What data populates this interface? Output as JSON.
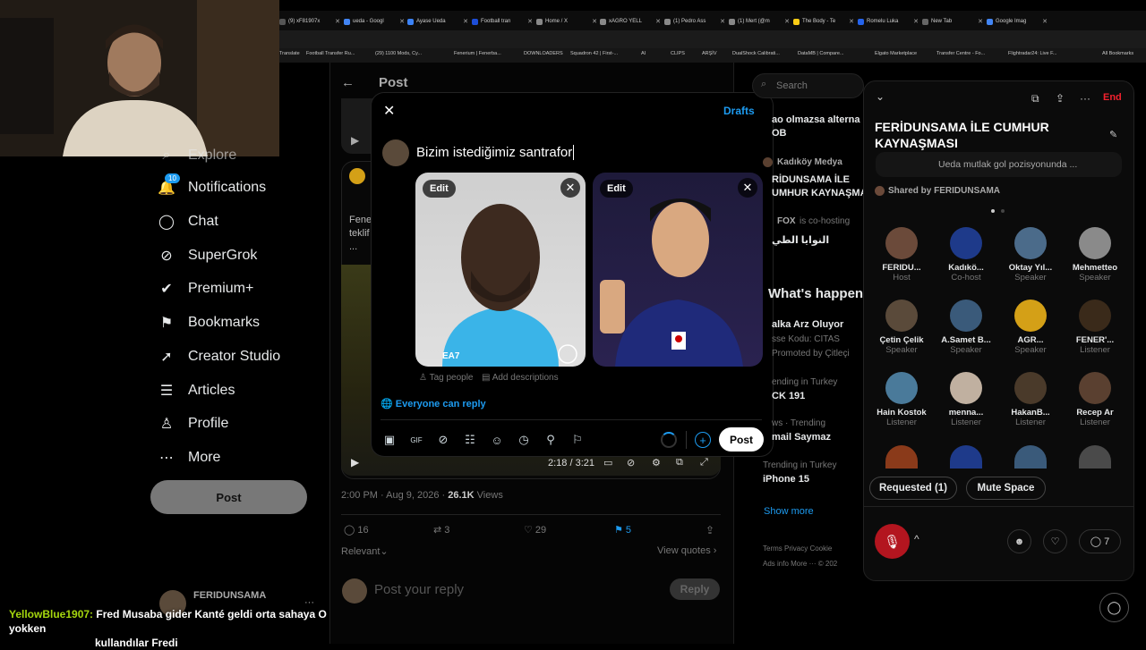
{
  "browser": {
    "tabs": [
      {
        "label": "(9) xF81907x",
        "color": "#555"
      },
      {
        "label": "ueda - Googl",
        "color": "#4285f4"
      },
      {
        "label": "Ayase Ueda",
        "color": "#3b82f6"
      },
      {
        "label": "Football tran",
        "color": "#1d4ed8"
      },
      {
        "label": "Home / X",
        "color": "#888"
      },
      {
        "label": "xAGRO YELL",
        "color": "#888"
      },
      {
        "label": "(1) Pedro Ass",
        "color": "#888"
      },
      {
        "label": "(1) Mert (@m",
        "color": "#888"
      },
      {
        "label": "The Body - Te",
        "color": "#facc15"
      },
      {
        "label": "Romelu Luka",
        "color": "#2563eb"
      },
      {
        "label": "New Tab",
        "color": "#666"
      },
      {
        "label": "Google Imag",
        "color": "#4285f4"
      }
    ],
    "bookmarks": [
      "Translate",
      "Football Transfer Ru...",
      "(29) 1100 Mods, Cy...",
      "Fenerium | Fenerba...",
      "DOWNLOADERS",
      "Squadron 42 | First-...",
      "AI",
      "CLIPS",
      "ARŞİV",
      "DualShock Calibrati...",
      "DataMB | Compare...",
      "Elgato Marketplace",
      "Transfer Centre - Fo...",
      "Flightradar24: Live F...",
      "All Bookmarks"
    ]
  },
  "sidebar": {
    "items": [
      {
        "label": "Explore",
        "icon": "search-icon",
        "glyph": "⌕"
      },
      {
        "label": "Notifications",
        "icon": "bell-icon",
        "glyph": "🔔",
        "badge": "10"
      },
      {
        "label": "Chat",
        "icon": "chat-icon",
        "glyph": "◯"
      },
      {
        "label": "SuperGrok",
        "icon": "grok-icon",
        "glyph": "⊘"
      },
      {
        "label": "Premium+",
        "icon": "verified-icon",
        "glyph": "✔"
      },
      {
        "label": "Bookmarks",
        "icon": "bookmark-icon",
        "glyph": "⚑"
      },
      {
        "label": "Creator Studio",
        "icon": "rocket-icon",
        "glyph": "➚"
      },
      {
        "label": "Articles",
        "icon": "article-icon",
        "glyph": "☰"
      },
      {
        "label": "Profile",
        "icon": "person-icon",
        "glyph": "♙"
      },
      {
        "label": "More",
        "icon": "more-icon",
        "glyph": "⋯"
      }
    ],
    "post_button": "Post",
    "account_name": "FERIDUNSAMA"
  },
  "main": {
    "header": "Post",
    "tweet_preview": {
      "text1": "Fene",
      "text2": "teklif",
      "time_now": "2:18",
      "time_total": "3:21",
      "ellipsis": "..."
    },
    "meta": {
      "datetime": "2:00 PM · Aug 9, 2026 · ",
      "views": "26.1K",
      "views_label": "Views"
    },
    "actions": {
      "replies": "16",
      "reposts": "3",
      "likes": "29",
      "bookmarks": "5"
    },
    "relevant": "Relevant",
    "view_quotes": "View quotes",
    "reply_placeholder": "Post your reply",
    "reply_button": "Reply"
  },
  "compose": {
    "drafts": "Drafts",
    "text": "Bizim istediğimiz santrafor",
    "edit_label": "Edit",
    "tag_people": "Tag people",
    "add_descriptions": "Add descriptions",
    "reply_setting": "Everyone can reply",
    "post_button": "Post"
  },
  "right": {
    "search_placeholder": "Search",
    "trend_snippets": [
      "ao olmazsa alterna",
      "OB"
    ],
    "kadikoy": "Kadıköy Medya",
    "feridun_line1": "RİDUNSAMA İLE",
    "feridun_line2": "UMHUR KAYNAŞMA",
    "fox": "FOX",
    "fox_cohost": "is co-hosting",
    "arabic": "النوايا الطي",
    "whats_happening": "What's happen",
    "trends": [
      {
        "title": "alka Arz Oluyor",
        "sub": "sse Kodu: CITAS",
        "sub2": "Promoted by Çitleçi"
      },
      {
        "small": "ending in Turkey",
        "title": "CK 191"
      },
      {
        "small": "ws · Trending",
        "title": "mail Saymaz"
      },
      {
        "small": "Trending in Turkey",
        "title": "iPhone 15"
      }
    ],
    "show_more": "Show more",
    "footer1": "Terms    Privacy    Cookie",
    "footer2": "Ads info    More ···    © 202"
  },
  "space": {
    "end": "End",
    "title": "FERİDUNSAMA İLE CUMHUR KAYNAŞMASI",
    "pinned": "Ueda mutlak gol pozisyonunda ...",
    "shared_by": "Shared by FERIDUNSAMA",
    "participants": [
      {
        "name": "FERIDU...",
        "role": "Host",
        "color": "#6b4a3a"
      },
      {
        "name": "Kadıkö...",
        "role": "Co-host",
        "color": "#1e3a8a"
      },
      {
        "name": "Oktay Yıl...",
        "role": "Speaker",
        "color": "#4b6b8a"
      },
      {
        "name": "Mehmetteo",
        "role": "Speaker",
        "color": "#8a8a8a"
      },
      {
        "name": "Çetin Çelik",
        "role": "Speaker",
        "color": "#5a4a3a"
      },
      {
        "name": "A.Samet B...",
        "role": "Speaker",
        "color": "#3a5a7a"
      },
      {
        "name": "AGR...",
        "role": "Speaker",
        "color": "#d4a017"
      },
      {
        "name": "FENER'...",
        "role": "Listener",
        "color": "#3a2a1a"
      },
      {
        "name": "Hain Kostok",
        "role": "Listener",
        "color": "#4a7a9a"
      },
      {
        "name": "menna...",
        "role": "Listener",
        "color": "#c0b0a0"
      },
      {
        "name": "HakanB...",
        "role": "Listener",
        "color": "#4a3a2a"
      },
      {
        "name": "Recep Ar",
        "role": "Listener",
        "color": "#5a4030"
      }
    ],
    "requested": "Requested (1)",
    "mute_space": "Mute Space",
    "comments": "7"
  },
  "chat": {
    "user": "YellowBlue1907:",
    "message": "Fred Musaba gider Kanté geldi orta sahaya O yokken",
    "message2": "kullandılar Fredi"
  }
}
